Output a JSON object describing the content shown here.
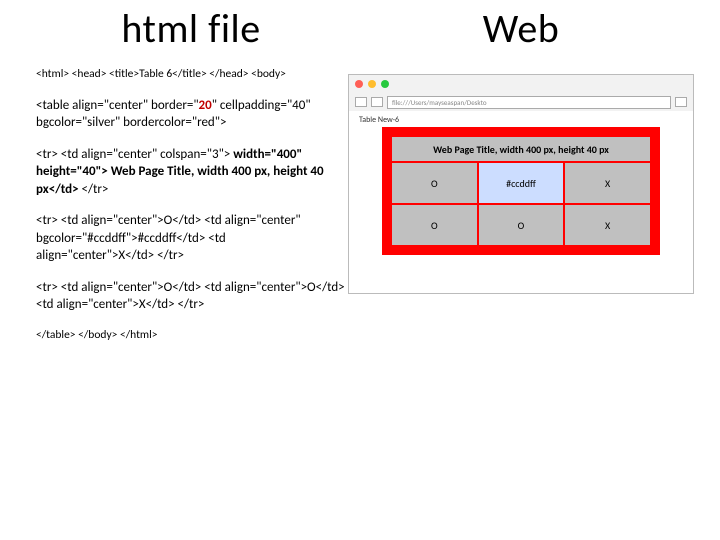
{
  "left": {
    "heading": "html file",
    "line1": "<html> <head> <title>Table 6</title> </head> <body>",
    "tbl_open_part1": "<table align=\"center\" border=\"",
    "tbl_open_border": "20",
    "tbl_open_part2": "\" cellpadding=\"40\" bgcolor=\"silver\" bordercolor=\"red\">",
    "row1_part1": "<tr> <td align=\"center\" colspan=\"3\"> ",
    "row1_bold": "width=\"400\" height=\"40\"> Web Page Title, width 400 px, height 40 px</td>",
    "row1_part2": " </tr>",
    "row2": "<tr> <td align=\"center\">O</td> <td align=\"center\" bgcolor=\"#ccddff\">#ccddff</td> <td align=\"center\">X</td> </tr>",
    "row3": "<tr> <td align=\"center\">O</td> <td align=\"center\">O</td> <td align=\"center\">X</td> </tr>",
    "close": "</table> </body> </html>"
  },
  "right": {
    "heading": "Web",
    "url": "file:///Users/mayseaspan/Deskto",
    "tab_label": "Table New-6",
    "page_title": "Web Page Title, width 400 px, height 40 px",
    "cells": {
      "r1c1": "O",
      "r1c2": "#ccddff",
      "r1c3": "X",
      "r2c1": "O",
      "r2c2": "O",
      "r2c3": "X"
    }
  }
}
